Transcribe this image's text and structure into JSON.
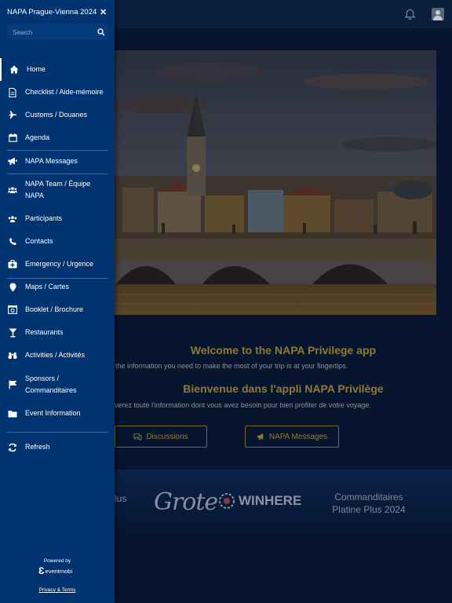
{
  "drawer": {
    "title": "NAPA Prague-Vienna 2024",
    "search_placeholder": "Search",
    "items": [
      {
        "label": "Home",
        "icon": "home-icon"
      },
      {
        "label": "Checklist / Aide-mémoire",
        "icon": "document-icon"
      },
      {
        "label": "Customs / Douanes",
        "icon": "airplane-icon"
      },
      {
        "label": "Agenda",
        "icon": "calendar-icon"
      },
      {
        "label": "NAPA Messages",
        "icon": "megaphone-icon"
      },
      {
        "label": "NAPA Team / Équipe NAPA",
        "icon": "team-icon"
      },
      {
        "label": "Participants",
        "icon": "users-icon"
      },
      {
        "label": "Contacts",
        "icon": "phone-icon"
      },
      {
        "label": "Emergency / Urgence",
        "icon": "first-aid-icon"
      },
      {
        "label": "Maps / Cartes",
        "icon": "map-pin-icon"
      },
      {
        "label": "Booklet / Brochure",
        "icon": "booklet-icon"
      },
      {
        "label": "Restaurants",
        "icon": "cocktail-icon"
      },
      {
        "label": "Activities / Activités",
        "icon": "binoculars-icon"
      },
      {
        "label": "Sponsors / Commanditaires",
        "icon": "flag-icon"
      },
      {
        "label": "Event Information",
        "icon": "folder-icon"
      }
    ],
    "refresh_label": "Refresh",
    "powered_by": "Powered by",
    "eventmobi": "eventmobi",
    "privacy_terms": "Privacy & Terms"
  },
  "main": {
    "welcome_title": "Welcome to the NAPA Privilege app",
    "welcome_sub": "the information you need to make the most of your trip is at your fingertips.",
    "bienvenue_title": "Bienvenue dans l'appli NAPA Privilège",
    "bienvenue_sub": "verez toute l'information dont vous avez besoin pour bien profiter de votre voyage.",
    "discussions_button": "Discussions",
    "messages_button": "NAPA Messages"
  },
  "sponsors": {
    "partial_plus": "lus",
    "grote": "Grote",
    "winhere": "WINHERE",
    "commanditaires": "Commanditaires Platine Plus 2024"
  },
  "colors": {
    "drawer_bg": "#003471",
    "gold_text": "#8f7a35",
    "page_bg": "#07162e"
  }
}
